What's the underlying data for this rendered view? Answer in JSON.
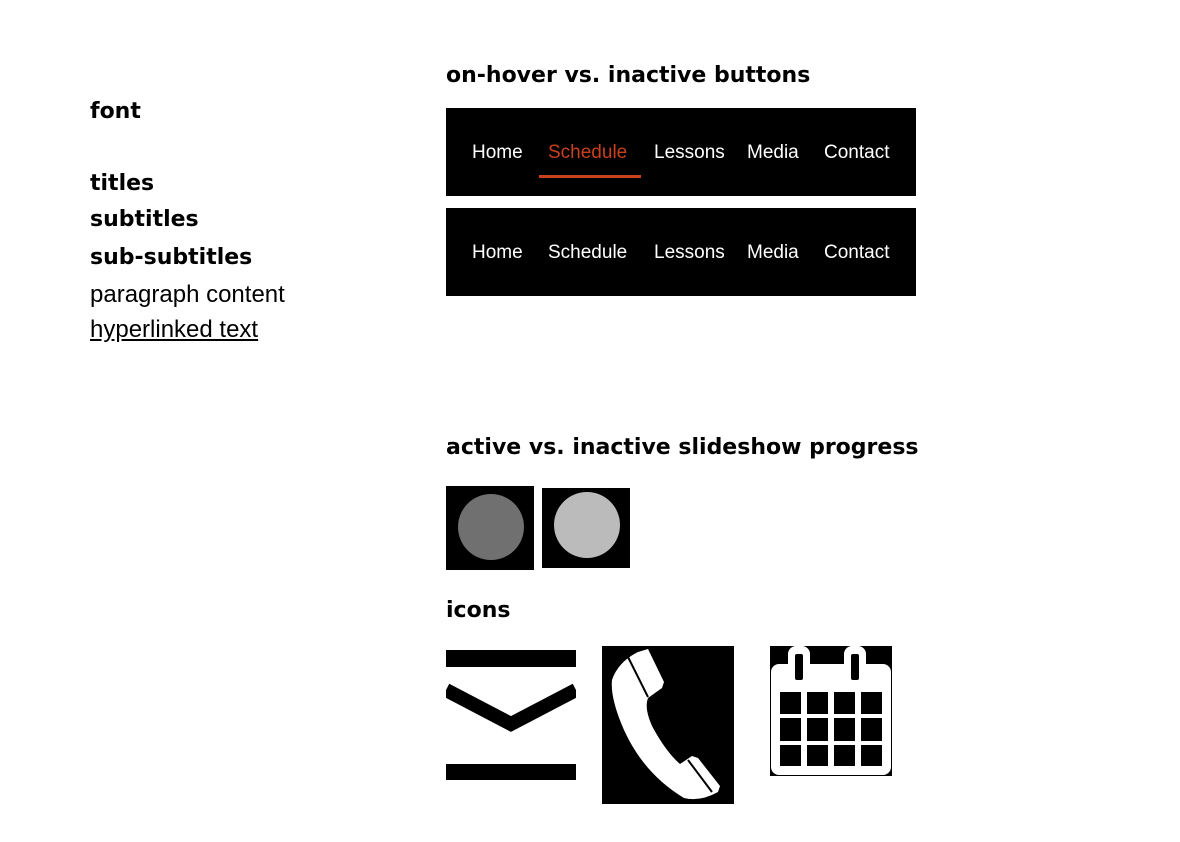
{
  "typography": {
    "heading": "font",
    "titles": "titles",
    "subtitles": "subtitles",
    "sub_subtitles": "sub-subtitles",
    "paragraph": "paragraph content",
    "hyperlink": "hyperlinked text"
  },
  "buttons_section": {
    "title": "on-hover vs. inactive  buttons",
    "accent_color": "#c8401c",
    "hover_nav": {
      "items": [
        "Home",
        "Schedule",
        "Lessons",
        "Media",
        "Contact"
      ],
      "hovered": "Schedule"
    },
    "inactive_nav": {
      "items": [
        "Home",
        "Schedule",
        "Lessons",
        "Media",
        "Contact"
      ]
    }
  },
  "slideshow_section": {
    "title": "active vs. inactive slideshow progress",
    "active_color": "#707070",
    "inactive_color": "#bbbbbb"
  },
  "icons_section": {
    "title": "icons",
    "icons": [
      "mail-icon",
      "phone-icon",
      "calendar-icon"
    ]
  }
}
